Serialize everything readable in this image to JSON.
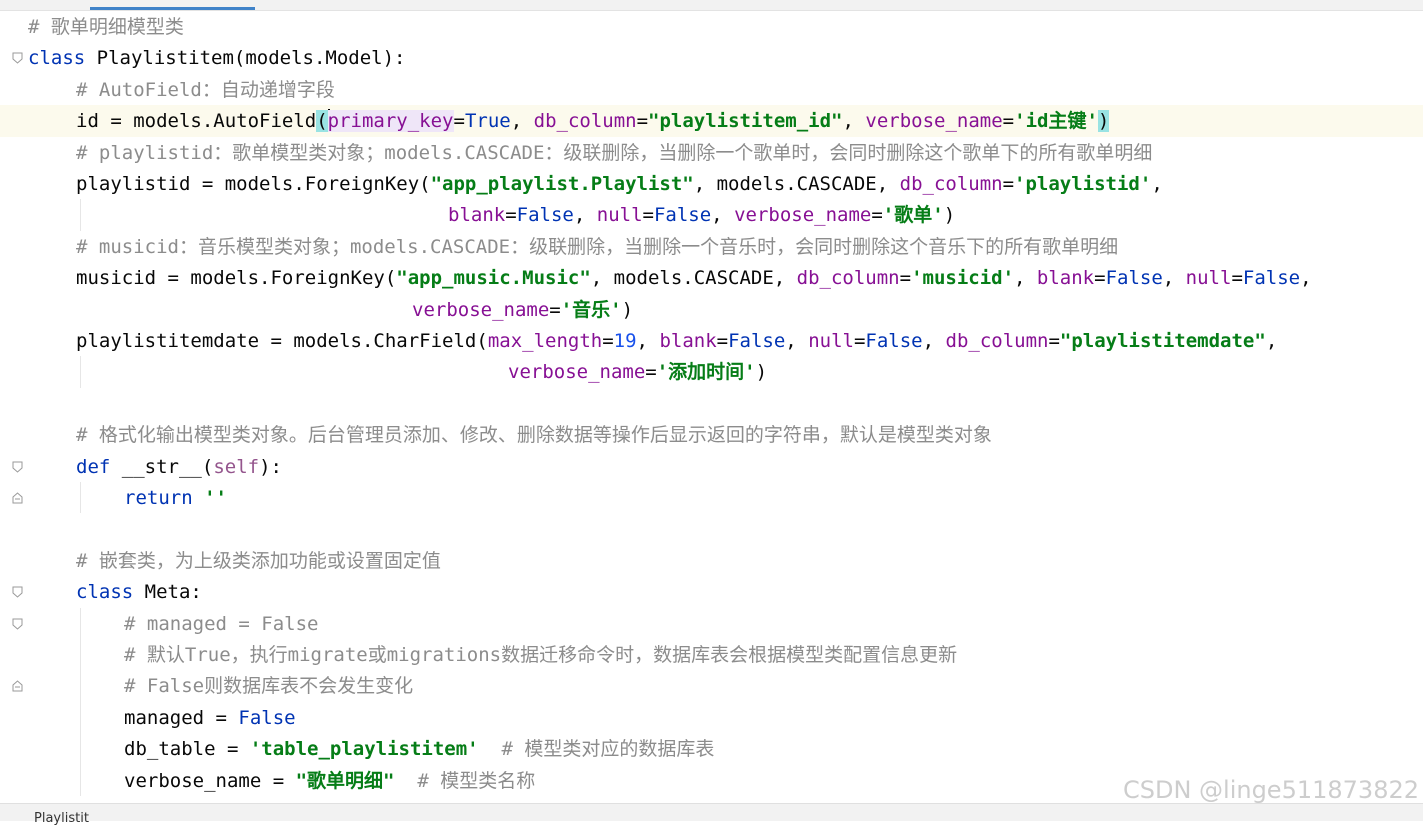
{
  "editor": {
    "lines": [
      {
        "indent": 0,
        "tokens": [
          [
            "cm",
            "# 歌单明细模型类"
          ]
        ]
      },
      {
        "indent": 0,
        "fold": "open",
        "tokens": [
          [
            "kw",
            "class"
          ],
          [
            "",
            "&nbsp;Playlistitem(models.Model):"
          ]
        ]
      },
      {
        "indent": 4,
        "tokens": [
          [
            "cm",
            "# AutoField：自动递增字段"
          ]
        ]
      },
      {
        "indent": 4,
        "current": true,
        "tokens": [
          [
            "",
            "id = models.AutoField"
          ],
          [
            "brace",
            "("
          ],
          [
            "caret",
            ""
          ],
          [
            "pa-hl",
            "primary_key"
          ],
          [
            "",
            "="
          ],
          [
            "kw",
            "True"
          ],
          [
            "",
            ", "
          ],
          [
            "pa",
            "db_column"
          ],
          [
            "",
            "="
          ],
          [
            "st",
            "\"playlistitem_id\""
          ],
          [
            "",
            ", "
          ],
          [
            "pa",
            "verbose_name"
          ],
          [
            "",
            "="
          ],
          [
            "st",
            "'id主键'"
          ],
          [
            "brace",
            ")"
          ]
        ]
      },
      {
        "indent": 4,
        "tokens": [
          [
            "cm",
            "# playlistid：歌单模型类对象；models.CASCADE：级联删除，当删除一个歌单时，会同时删除这个歌单下的所有歌单明细"
          ]
        ]
      },
      {
        "indent": 4,
        "tokens": [
          [
            "",
            "playlistid = models.ForeignKey("
          ],
          [
            "st",
            "\"app_playlist.Playlist\""
          ],
          [
            "",
            ", models.CASCADE, "
          ],
          [
            "pa",
            "db_column"
          ],
          [
            "",
            "="
          ],
          [
            "st",
            "'playlistid'"
          ],
          [
            "",
            ","
          ]
        ]
      },
      {
        "indent": 35,
        "guide": 4,
        "tokens": [
          [
            "pa",
            "blank"
          ],
          [
            "",
            "="
          ],
          [
            "kw",
            "False"
          ],
          [
            "",
            ", "
          ],
          [
            "pa",
            "null"
          ],
          [
            "",
            "="
          ],
          [
            "kw",
            "False"
          ],
          [
            "",
            ", "
          ],
          [
            "pa",
            "verbose_name"
          ],
          [
            "",
            "="
          ],
          [
            "st",
            "'歌单'"
          ],
          [
            "",
            ")"
          ]
        ]
      },
      {
        "indent": 4,
        "tokens": [
          [
            "cm",
            "# musicid：音乐模型类对象；models.CASCADE：级联删除，当删除一个音乐时，会同时删除这个音乐下的所有歌单明细"
          ]
        ]
      },
      {
        "indent": 4,
        "tokens": [
          [
            "",
            "musicid = models.ForeignKey("
          ],
          [
            "st",
            "\"app_music.Music\""
          ],
          [
            "",
            ", models.CASCADE, "
          ],
          [
            "pa",
            "db_column"
          ],
          [
            "",
            "="
          ],
          [
            "st",
            "'musicid'"
          ],
          [
            "",
            ", "
          ],
          [
            "pa",
            "blank"
          ],
          [
            "",
            "="
          ],
          [
            "kw",
            "False"
          ],
          [
            "",
            ", "
          ],
          [
            "pa",
            "null"
          ],
          [
            "",
            "="
          ],
          [
            "kw",
            "False"
          ],
          [
            "",
            ","
          ]
        ]
      },
      {
        "indent": 32,
        "tokens": [
          [
            "pa",
            "verbose_name"
          ],
          [
            "",
            "="
          ],
          [
            "st",
            "'音乐'"
          ],
          [
            "",
            ")"
          ]
        ]
      },
      {
        "indent": 4,
        "tokens": [
          [
            "",
            "playlistitemdate = models.CharField("
          ],
          [
            "pa",
            "max_length"
          ],
          [
            "",
            "="
          ],
          [
            "nu",
            "19"
          ],
          [
            "",
            ", "
          ],
          [
            "pa",
            "blank"
          ],
          [
            "",
            "="
          ],
          [
            "kw",
            "False"
          ],
          [
            "",
            ", "
          ],
          [
            "pa",
            "null"
          ],
          [
            "",
            "="
          ],
          [
            "kw",
            "False"
          ],
          [
            "",
            ", "
          ],
          [
            "pa",
            "db_column"
          ],
          [
            "",
            "="
          ],
          [
            "st",
            "\"playlistitemdate\""
          ],
          [
            "",
            ","
          ]
        ]
      },
      {
        "indent": 40,
        "guide": 4,
        "tokens": [
          [
            "pa",
            "verbose_name"
          ],
          [
            "",
            "="
          ],
          [
            "st",
            "'添加时间'"
          ],
          [
            "",
            ")"
          ]
        ]
      },
      {
        "indent": 0,
        "tokens": []
      },
      {
        "indent": 4,
        "tokens": [
          [
            "cm",
            "# 格式化输出模型类对象。后台管理员添加、修改、删除数据等操作后显示返回的字符串，默认是模型类对象"
          ]
        ]
      },
      {
        "indent": 4,
        "fold": "open",
        "tokens": [
          [
            "kw",
            "def"
          ],
          [
            "",
            "&nbsp;"
          ],
          [
            "",
            "__str__"
          ],
          [
            "",
            "("
          ],
          [
            "self",
            "self"
          ],
          [
            "",
            "):"
          ]
        ]
      },
      {
        "indent": 8,
        "fold": "close",
        "guide": 4,
        "tokens": [
          [
            "kw",
            "return"
          ],
          [
            "",
            "&nbsp;"
          ],
          [
            "st",
            "''"
          ]
        ]
      },
      {
        "indent": 0,
        "tokens": []
      },
      {
        "indent": 4,
        "tokens": [
          [
            "cm",
            "# 嵌套类，为上级类添加功能或设置固定值"
          ]
        ]
      },
      {
        "indent": 4,
        "fold": "open",
        "tokens": [
          [
            "kw",
            "class"
          ],
          [
            "",
            "&nbsp;Meta:"
          ]
        ]
      },
      {
        "indent": 8,
        "fold": "open",
        "guide": 4,
        "tokens": [
          [
            "cm",
            "# managed = False"
          ]
        ]
      },
      {
        "indent": 8,
        "guide": 4,
        "tokens": [
          [
            "cm",
            "# 默认True，执行migrate或migrations数据迁移命令时，数据库表会根据模型类配置信息更新"
          ]
        ]
      },
      {
        "indent": 8,
        "fold": "close",
        "guide": 4,
        "tokens": [
          [
            "cm",
            "# False则数据库表不会发生变化"
          ]
        ]
      },
      {
        "indent": 8,
        "guide": 4,
        "tokens": [
          [
            "",
            "managed = "
          ],
          [
            "kw",
            "False"
          ]
        ]
      },
      {
        "indent": 8,
        "guide": 4,
        "tokens": [
          [
            "",
            "db_table = "
          ],
          [
            "st",
            "'table_playlistitem'"
          ],
          [
            "",
            "&nbsp;&nbsp;"
          ],
          [
            "cm",
            "# 模型类对应的数据库表"
          ]
        ]
      },
      {
        "indent": 8,
        "guide": 4,
        "tokens": [
          [
            "",
            "verbose_name = "
          ],
          [
            "st",
            "\"歌单明细\""
          ],
          [
            "",
            "&nbsp;&nbsp;"
          ],
          [
            "cm",
            "# 模型类名称"
          ]
        ]
      }
    ]
  },
  "statusbar": {
    "breadcrumb": "Playlistit"
  },
  "watermark": "CSDN @linge511873822",
  "colors": {
    "keyword": "#0033b3",
    "comment": "#8c8c8c",
    "string": "#067d17",
    "param": "#871094",
    "number": "#1750eb",
    "current_line": "#fcfaed"
  }
}
